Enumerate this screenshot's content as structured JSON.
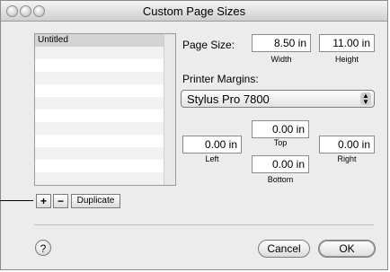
{
  "window": {
    "title": "Custom Page Sizes"
  },
  "list": {
    "items": [
      "Untitled"
    ]
  },
  "list_buttons": {
    "add": "+",
    "remove": "−",
    "duplicate": "Duplicate"
  },
  "page_size": {
    "label": "Page Size:",
    "width_value": "8.50 in",
    "height_value": "11.00 in",
    "width_label": "Width",
    "height_label": "Height"
  },
  "printer_margins": {
    "label": "Printer Margins:",
    "printer_selected": "Stylus Pro 7800",
    "top_value": "0.00 in",
    "left_value": "0.00 in",
    "right_value": "0.00 in",
    "bottom_value": "0.00 in",
    "top_label": "Top",
    "left_label": "Left",
    "right_label": "Right",
    "bottom_label": "Bottom"
  },
  "footer": {
    "help": "?",
    "cancel": "Cancel",
    "ok": "OK"
  }
}
